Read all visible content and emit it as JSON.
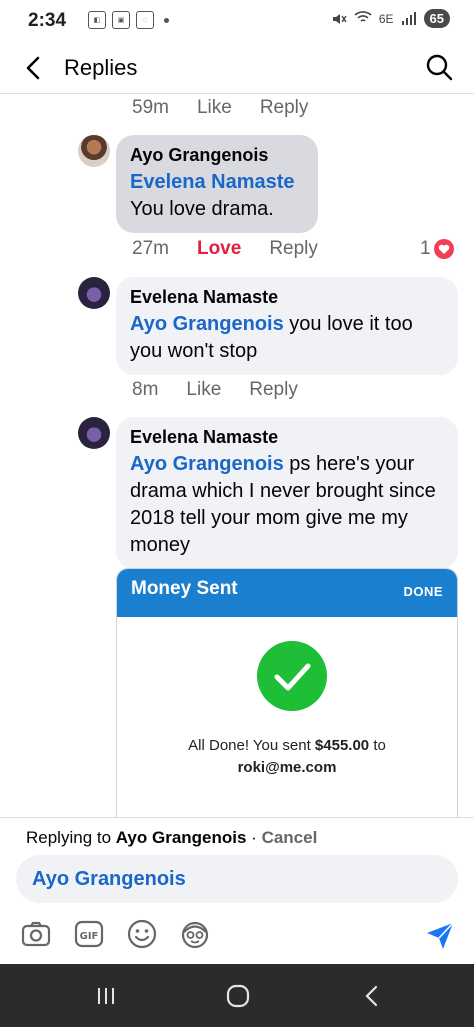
{
  "status_bar": {
    "time": "2:34",
    "battery": "65",
    "network": "6E"
  },
  "header": {
    "title": "Replies"
  },
  "comments": [
    {
      "time": "59m",
      "action1": "Like",
      "action2": "Reply"
    },
    {
      "author": "Ayo Grangenois",
      "mention": "Evelena Namaste",
      "text": "You love drama.",
      "time": "27m",
      "reaction_label": "Love",
      "reply_label": "Reply",
      "reaction_count": "1"
    },
    {
      "author": "Evelena Namaste",
      "mention": "Ayo Grangenois",
      "text": " you love it too you won't stop",
      "time": "8m",
      "like_label": "Like",
      "reply_label": "Reply"
    },
    {
      "author": "Evelena Namaste",
      "mention": "Ayo Grangenois",
      "text": " ps here's your drama which I never brought since 2018 tell your mom give me my money"
    }
  ],
  "money_card": {
    "title": "Money Sent",
    "done": "DONE",
    "msg_prefix": "All Done! You sent ",
    "amount": "$455.00",
    "msg_to": " to",
    "email": "roki@me.com"
  },
  "reply_bar": {
    "replying_prefix": "Replying to ",
    "replying_name": "Ayo Grangenois",
    "separator": " · ",
    "cancel": "Cancel",
    "input_value": "Ayo Grangenois"
  },
  "colors": {
    "accent": "#1a67c9",
    "love": "#e41e3f",
    "send": "#1877f2",
    "money_header": "#1b7fd0",
    "check": "#1ebf36"
  }
}
